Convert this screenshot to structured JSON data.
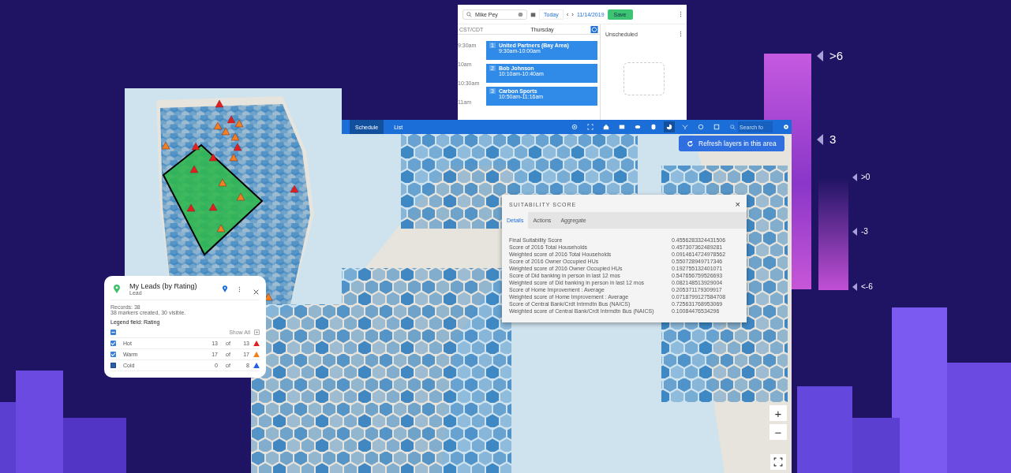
{
  "calendar": {
    "search": {
      "value": "Mike Pey"
    },
    "today": "Today",
    "prev": "‹",
    "next": "›",
    "date": "11/14/2019",
    "save": "Save",
    "timezone": "CST/CDT",
    "day": "Thursday",
    "unscheduled": "Unscheduled",
    "times": [
      "9:30am",
      "10am",
      "10:30am",
      "11am"
    ],
    "events": [
      {
        "number": "1",
        "title": "United Partners (Bay Area)",
        "time": "9:30am-10:00am"
      },
      {
        "number": "2",
        "title": "Bob Johnson",
        "time": "10:10am-10:40am"
      },
      {
        "number": "3",
        "title": "Carbon Sports",
        "time": "10:50am-11:16am"
      }
    ]
  },
  "map_window": {
    "tabs": [
      {
        "label": "Schedule",
        "selected": true
      },
      {
        "label": "List",
        "selected": false
      }
    ],
    "search": {
      "placeholder": "Search fo"
    },
    "refresh": "Refresh layers in this area",
    "zoom_in": "+",
    "zoom_out": "−",
    "popup": {
      "title": "SUITABILITY SCORE",
      "close": "×",
      "tabs": [
        {
          "label": "Details",
          "selected": true
        },
        {
          "label": "Actions",
          "selected": false
        },
        {
          "label": "Aggregate",
          "selected": false
        }
      ],
      "rows": [
        {
          "label": "Final Suitability Score",
          "value": "0.4556283324431506"
        },
        {
          "label": "Score of 2016 Total Households",
          "value": "0.457307362489281"
        },
        {
          "label": "Weighted score of 2016 Total Households",
          "value": "0.0914614724978562"
        },
        {
          "label": "Score of 2016 Owner Occupied HUs",
          "value": "0.550728949717346"
        },
        {
          "label": "Weighted score of 2016 Owner Occupied HUs",
          "value": "0.192755132401071"
        },
        {
          "label": "Score of Did banking in person in last 12 mos",
          "value": "0.547656759526693"
        },
        {
          "label": "Weighted score of Did banking in person in last 12 mos",
          "value": "0.082148513929004"
        },
        {
          "label": "Score of Home Improvement : Average",
          "value": "0.205371179309917"
        },
        {
          "label": "Weighted score of Home Improvement : Average",
          "value": "0.0718799127584708"
        },
        {
          "label": "Score of Central Bank/Crdt Intrmdtn Bus (NAICS)",
          "value": "0.725631768953069"
        },
        {
          "label": "Weighted score of Central Bank/Crdt Intrmdtn Bus (NAICS)",
          "value": "0.10084476534296"
        }
      ]
    }
  },
  "leads_card": {
    "title": "My Leads (by Rating)",
    "subtitle": "Lead",
    "records": "Records: 38",
    "markers": "38 markers created, 30 visible.",
    "legend_field": "Legend field: Rating",
    "show_all": "Show All",
    "select_all": {
      "indeterminate": true
    },
    "rows": [
      {
        "label": "Hot",
        "count": "13",
        "of": "of",
        "total": "13",
        "checked": true,
        "color": "#e02020"
      },
      {
        "label": "Warm",
        "count": "17",
        "of": "of",
        "total": "17",
        "checked": true,
        "color": "#f08020"
      },
      {
        "label": "Cold",
        "count": "0",
        "of": "of",
        "total": "8",
        "checked": false,
        "color": "#2060e0"
      }
    ]
  },
  "scale_large": {
    "labels": [
      ">6",
      "3"
    ]
  },
  "scale_small": {
    "labels": [
      ">0",
      "-3",
      "<-6"
    ]
  }
}
